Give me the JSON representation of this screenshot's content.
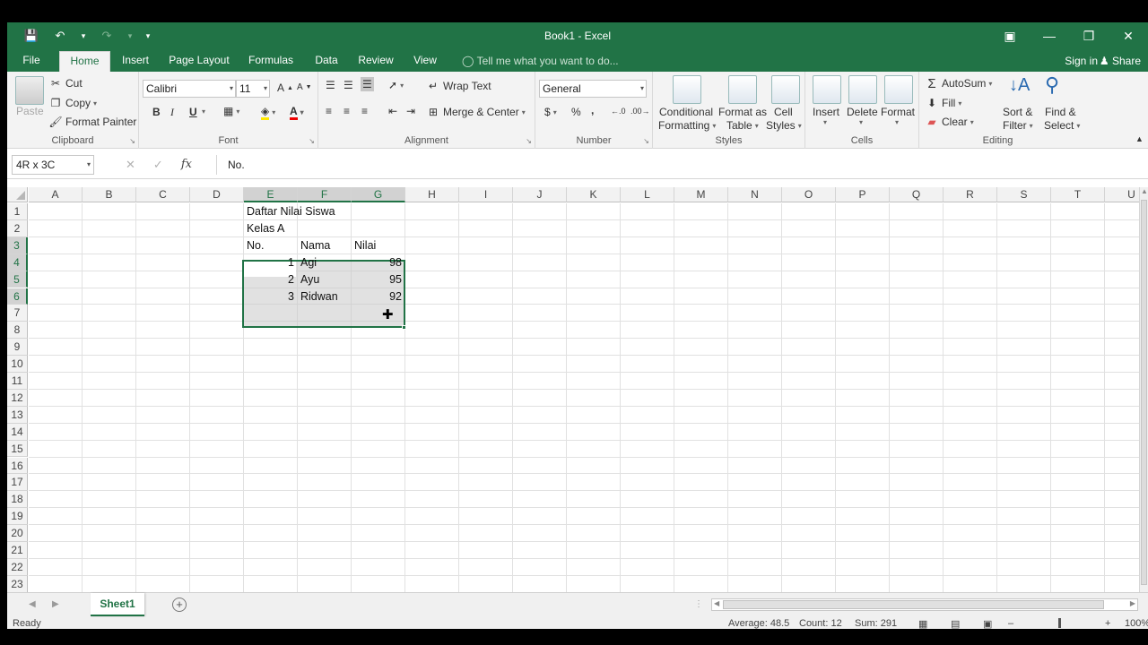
{
  "window": {
    "title": "Book1 - Excel"
  },
  "tabs": [
    "File",
    "Home",
    "Insert",
    "Page Layout",
    "Formulas",
    "Data",
    "Review",
    "View"
  ],
  "tell_me": "Tell me what you want to do...",
  "account": {
    "sign_in": "Sign in",
    "share": "Share"
  },
  "ribbon": {
    "clipboard": {
      "label": "Clipboard",
      "paste": "Paste",
      "cut": "Cut",
      "copy": "Copy",
      "format_painter": "Format Painter"
    },
    "font": {
      "label": "Font",
      "name": "Calibri",
      "size": "11",
      "bold": "B",
      "italic": "I",
      "underline": "U"
    },
    "alignment": {
      "label": "Alignment",
      "wrap_text": "Wrap Text",
      "merge_center": "Merge & Center"
    },
    "number": {
      "label": "Number",
      "format": "General",
      "currency": "$",
      "percent": "%",
      "comma": ","
    },
    "styles": {
      "label": "Styles",
      "conditional_1": "Conditional",
      "conditional_2": "Formatting",
      "format_as_1": "Format as",
      "format_as_2": "Table",
      "cell_styles_1": "Cell",
      "cell_styles_2": "Styles"
    },
    "cells": {
      "label": "Cells",
      "insert": "Insert",
      "delete": "Delete",
      "format": "Format"
    },
    "editing": {
      "label": "Editing",
      "autosum": "AutoSum",
      "fill": "Fill",
      "clear": "Clear",
      "sort_1": "Sort &",
      "sort_2": "Filter",
      "find_1": "Find &",
      "find_2": "Select"
    }
  },
  "formula_bar": {
    "name_box": "4R x 3C",
    "content": "No."
  },
  "columns": [
    "A",
    "B",
    "C",
    "D",
    "E",
    "F",
    "G",
    "H",
    "I",
    "J",
    "K",
    "L",
    "M",
    "N",
    "O",
    "P",
    "Q",
    "R",
    "S",
    "T",
    "U"
  ],
  "rows": [
    "1",
    "2",
    "3",
    "4",
    "5",
    "6",
    "7",
    "8",
    "9",
    "10",
    "11",
    "12",
    "13",
    "14",
    "15",
    "16",
    "17",
    "18",
    "19",
    "20",
    "21",
    "22",
    "23"
  ],
  "cells": {
    "E1": "Daftar Nilai Siswa",
    "E2": "Kelas A",
    "E3": "No.",
    "F3": "Nama",
    "G3": "Nilai",
    "E4": "1",
    "F4": "Agi",
    "G4": "98",
    "E5": "2",
    "F5": "Ayu",
    "G5": "95",
    "E6": "3",
    "F6": "Ridwan",
    "G6": "92"
  },
  "sheet_tabs": [
    "Sheet1"
  ],
  "status": {
    "ready": "Ready",
    "average": "Average: 48.5",
    "count": "Count: 12",
    "sum": "Sum: 291",
    "zoom": "100%"
  }
}
